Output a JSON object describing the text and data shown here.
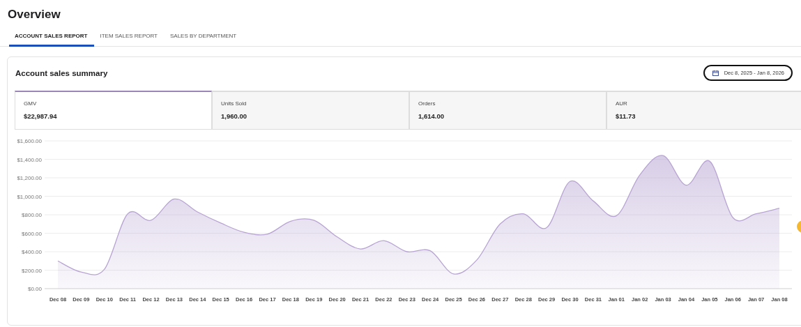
{
  "page_title": "Overview",
  "tabs": [
    {
      "label": "ACCOUNT SALES REPORT",
      "selected": true
    },
    {
      "label": "ITEM SALES REPORT",
      "selected": false
    },
    {
      "label": "SALES BY DEPARTMENT",
      "selected": false
    }
  ],
  "summary": {
    "title": "Account sales summary",
    "date_range": "Dec 8, 2025 - Jan 8, 2026",
    "metrics": [
      {
        "label": "GMV",
        "value": "$22,987.94",
        "selected": true
      },
      {
        "label": "Units Sold",
        "value": "1,960.00",
        "selected": false
      },
      {
        "label": "Orders",
        "value": "1,614.00",
        "selected": false
      },
      {
        "label": "AUR",
        "value": "$11.73",
        "selected": false
      }
    ],
    "chart_data": {
      "type": "area",
      "categories": [
        "Dec 08",
        "Dec 09",
        "Dec 10",
        "Dec 11",
        "Dec 12",
        "Dec 13",
        "Dec 14",
        "Dec 15",
        "Dec 16",
        "Dec 17",
        "Dec 18",
        "Dec 19",
        "Dec 20",
        "Dec 21",
        "Dec 22",
        "Dec 23",
        "Dec 24",
        "Dec 25",
        "Dec 26",
        "Dec 27",
        "Dec 28",
        "Dec 29",
        "Dec 30",
        "Dec 31",
        "Jan 01",
        "Jan 02",
        "Jan 03",
        "Jan 04",
        "Jan 05",
        "Jan 06",
        "Jan 07",
        "Jan 08"
      ],
      "grid": true,
      "series": [
        {
          "color": "#b7a4d2",
          "values": [
            300,
            180,
            210,
            810,
            740,
            970,
            830,
            710,
            610,
            590,
            730,
            740,
            560,
            430,
            520,
            400,
            410,
            160,
            310,
            700,
            810,
            660,
            1160,
            950,
            790,
            1230,
            1440,
            1120,
            1380,
            770,
            810,
            870
          ]
        }
      ],
      "ylim": [
        0,
        1600
      ],
      "yticks": [
        {
          "value": 0,
          "label": "$0.00"
        },
        {
          "value": 200,
          "label": "$200.00"
        },
        {
          "value": 400,
          "label": "$400.00"
        },
        {
          "value": 600,
          "label": "$600.00"
        },
        {
          "value": 800,
          "label": "$800.00"
        },
        {
          "value": 1000,
          "label": "$1,000.00"
        },
        {
          "value": 1200,
          "label": "$1,200.00"
        },
        {
          "value": 1400,
          "label": "$1,400.00"
        },
        {
          "value": 1600,
          "label": "$1,600.00"
        }
      ]
    }
  }
}
